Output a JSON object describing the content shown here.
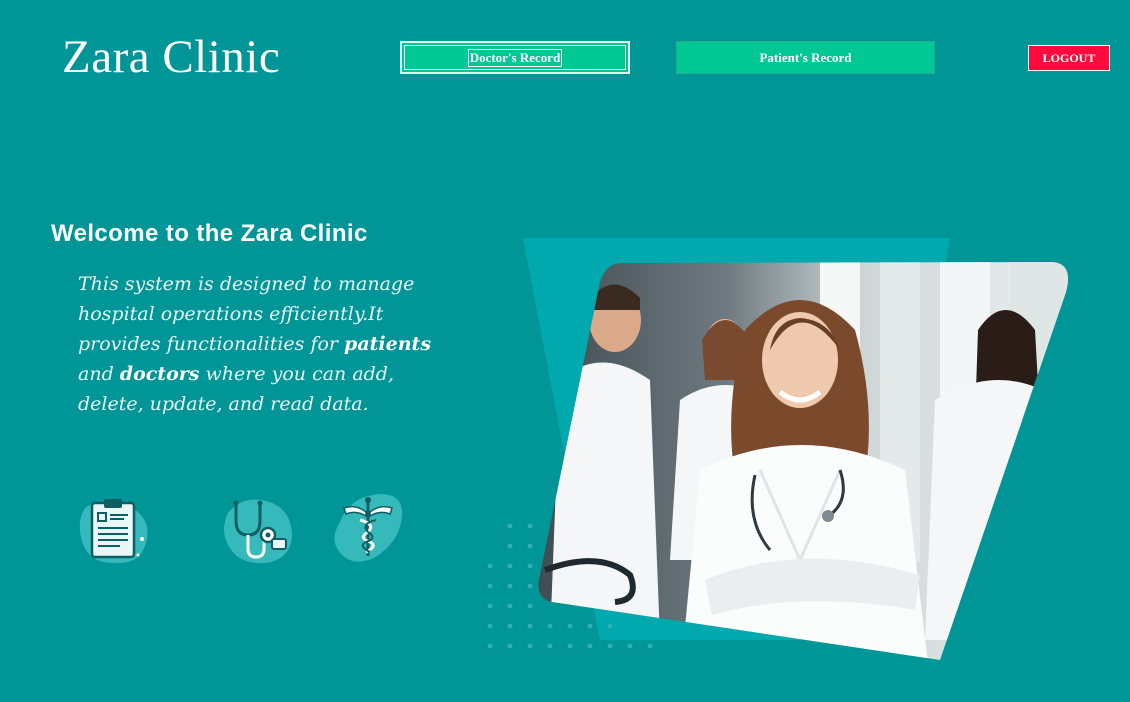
{
  "header": {
    "app_title": "Zara Clinic",
    "nav": {
      "doctors_label": "Doctor's Record",
      "patients_label": "Patient's Record"
    },
    "logout_label": "LOGOUT"
  },
  "hero": {
    "heading": "Welcome to the Zara Clinic",
    "desc_part1": "This system is designed to manage hospital operations efficiently.It provides functionalities for ",
    "desc_bold1": "patients",
    "desc_part2": " and ",
    "desc_bold2": "doctors",
    "desc_part3": " where you can add, delete, update, and read data."
  },
  "icons": [
    "clipboard-icon",
    "stethoscope-icon",
    "caduceus-icon"
  ],
  "colors": {
    "background": "#009597",
    "nav_button": "#00c894",
    "logout": "#ff0a3c"
  }
}
